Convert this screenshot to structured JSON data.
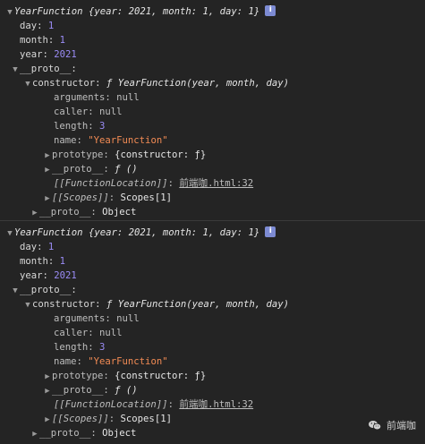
{
  "entries": [
    {
      "summary_name": "YearFunction",
      "summary_obj": "{year: 2021, month: 1, day: 1}",
      "day_key": "day",
      "day_val": "1",
      "month_key": "month",
      "month_val": "1",
      "year_key": "year",
      "year_val": "2021",
      "proto_key": "__proto__",
      "constructor_key": "constructor",
      "constructor_val": "ƒ YearFunction(year, month, day)",
      "arguments_key": "arguments",
      "arguments_val": "null",
      "caller_key": "caller",
      "caller_val": "null",
      "length_key": "length",
      "length_val": "3",
      "name_key": "name",
      "name_val": "\"YearFunction\"",
      "prototype_key": "prototype",
      "prototype_val": "{constructor: ƒ}",
      "inner_proto_key": "__proto__",
      "inner_proto_val": "ƒ ()",
      "fn_location_key": "[[FunctionLocation]]",
      "fn_location_val": "前端咖.html:32",
      "scopes_key": "[[Scopes]]",
      "scopes_val": "Scopes[1]",
      "outer_proto_key": "__proto__",
      "outer_proto_val": "Object"
    },
    {
      "summary_name": "YearFunction",
      "summary_obj": "{year: 2021, month: 1, day: 1}",
      "day_key": "day",
      "day_val": "1",
      "month_key": "month",
      "month_val": "1",
      "year_key": "year",
      "year_val": "2021",
      "proto_key": "__proto__",
      "constructor_key": "constructor",
      "constructor_val": "ƒ YearFunction(year, month, day)",
      "arguments_key": "arguments",
      "arguments_val": "null",
      "caller_key": "caller",
      "caller_val": "null",
      "length_key": "length",
      "length_val": "3",
      "name_key": "name",
      "name_val": "\"YearFunction\"",
      "prototype_key": "prototype",
      "prototype_val": "{constructor: ƒ}",
      "inner_proto_key": "__proto__",
      "inner_proto_val": "ƒ ()",
      "fn_location_key": "[[FunctionLocation]]",
      "fn_location_val": "前端咖.html:32",
      "scopes_key": "[[Scopes]]",
      "scopes_val": "Scopes[1]",
      "outer_proto_key": "__proto__",
      "outer_proto_val": "Object"
    }
  ],
  "watermark": {
    "label": "前端咖"
  },
  "icons": {
    "expanded": "triangle-down-icon",
    "collapsed": "triangle-right-icon",
    "info": "info-icon",
    "wechat": "wechat-icon"
  }
}
